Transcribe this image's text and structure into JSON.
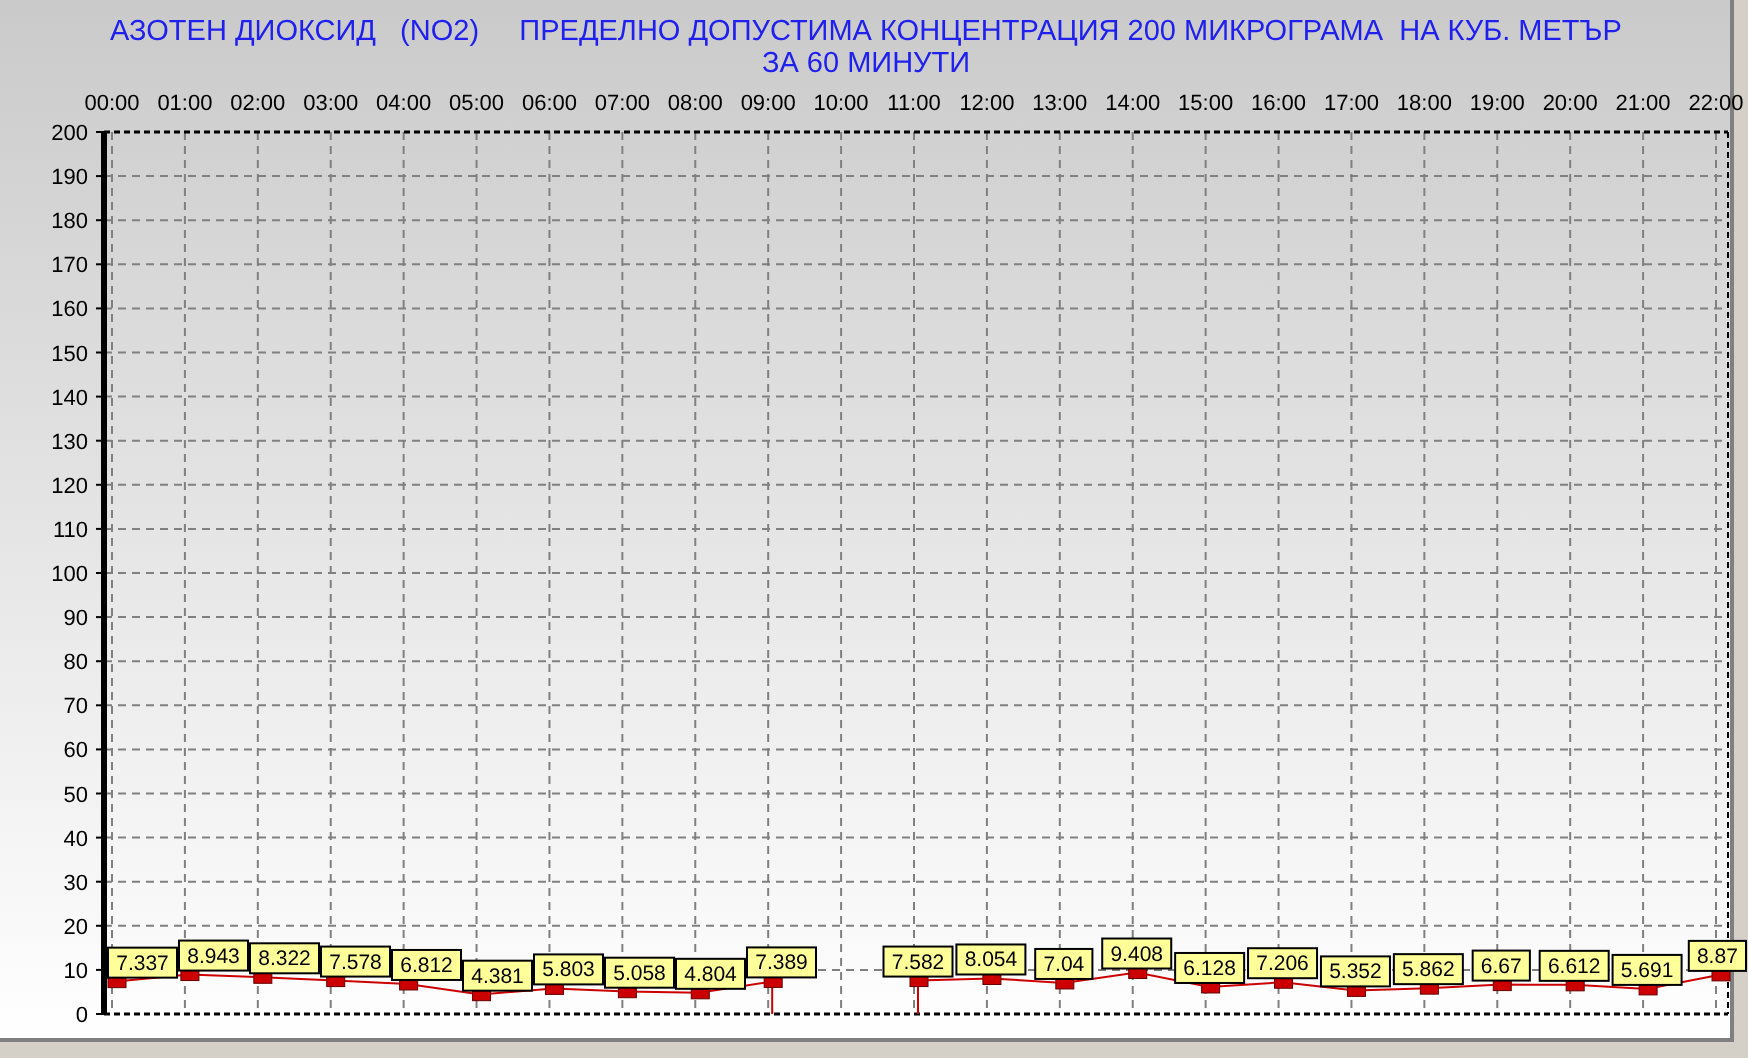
{
  "chart": {
    "chart_data": {
      "type": "line",
      "title": "АЗОТЕН ДИОКСИД   (NO2)     ПРЕДЕЛНО ДОПУСТИМА КОНЦЕНТРАЦИЯ 200 МИКРОГРАМА  НА КУБ. МЕТЪР\nЗА 60 МИНУТИ",
      "categories": [
        "00:00",
        "01:00",
        "02:00",
        "03:00",
        "04:00",
        "05:00",
        "06:00",
        "07:00",
        "08:00",
        "09:00",
        "10:00",
        "11:00",
        "12:00",
        "13:00",
        "14:00",
        "15:00",
        "16:00",
        "17:00",
        "18:00",
        "19:00",
        "20:00",
        "21:00",
        "22:00"
      ],
      "grid": true,
      "series": [
        {
          "color": "#cc0000",
          "marker": "square",
          "values": [
            7.337,
            8.943,
            8.322,
            7.578,
            6.812,
            4.381,
            5.803,
            5.058,
            4.804,
            7.389,
            null,
            7.582,
            8.054,
            7.04,
            9.408,
            6.128,
            7.206,
            5.352,
            5.862,
            6.67,
            6.612,
            5.691,
            8.87
          ]
        }
      ],
      "value_labels": [
        "7.337",
        "8.943",
        "8.322",
        "7.578",
        "6.812",
        "4.381",
        "5.803",
        "5.058",
        "4.804",
        "7.389",
        null,
        "7.582",
        "8.054",
        "7.04",
        "9.408",
        "6.128",
        "7.206",
        "5.352",
        "5.862",
        "6.67",
        "6.612",
        "5.691",
        "8.87"
      ],
      "ylim": [
        0,
        200
      ],
      "yticks": [
        0,
        10,
        20,
        30,
        40,
        50,
        60,
        70,
        80,
        90,
        100,
        110,
        120,
        130,
        140,
        150,
        160,
        170,
        180,
        190,
        200
      ]
    }
  }
}
